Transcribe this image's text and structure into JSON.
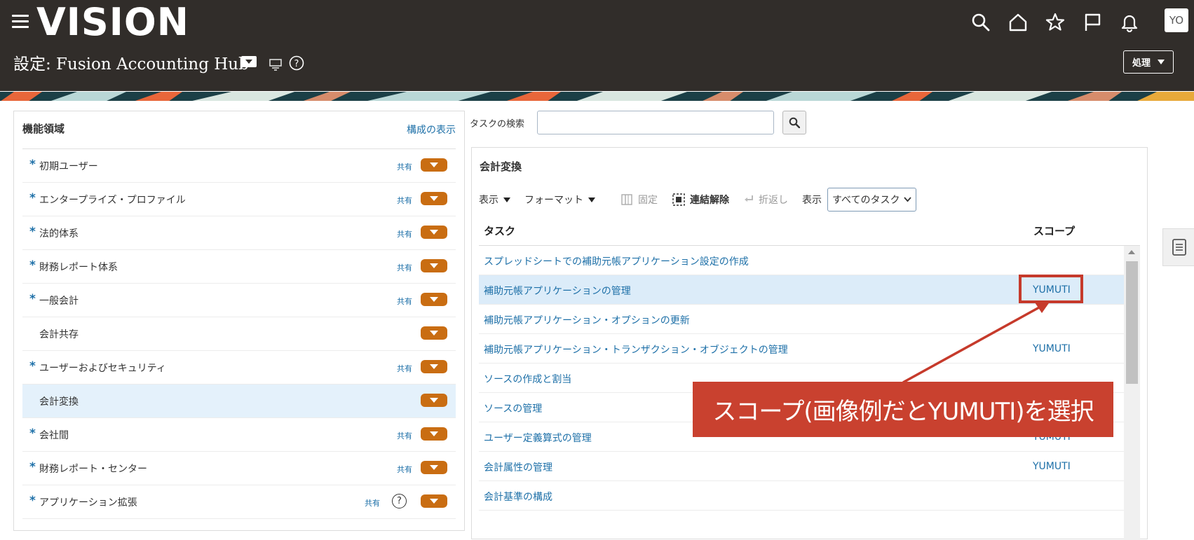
{
  "header": {
    "logo": "VISION",
    "page_title": "設定: Fusion Accounting Hub",
    "action_label": "処理",
    "avatar_initials": "YO",
    "icons": [
      "search-icon",
      "home-icon",
      "star-icon",
      "flag-icon",
      "bell-icon"
    ]
  },
  "left_panel": {
    "title": "機能領域",
    "link": "構成の表示",
    "items": [
      {
        "label": "初期ユーザー",
        "required": "*",
        "shared": "共有"
      },
      {
        "label": "エンタープライズ・プロファイル",
        "required": "*",
        "shared": "共有"
      },
      {
        "label": "法的体系",
        "required": "*",
        "shared": "共有"
      },
      {
        "label": "財務レポート体系",
        "required": "*",
        "shared": "共有"
      },
      {
        "label": "一般会計",
        "required": "*",
        "shared": "共有"
      },
      {
        "label": "会計共存",
        "required": "",
        "shared": ""
      },
      {
        "label": "ユーザーおよびセキュリティ",
        "required": "*",
        "shared": "共有"
      },
      {
        "label": "会計変換",
        "required": "",
        "shared": ""
      },
      {
        "label": "会社間",
        "required": "*",
        "shared": "共有"
      },
      {
        "label": "財務レポート・センター",
        "required": "*",
        "shared": "共有"
      },
      {
        "label": "アプリケーション拡張",
        "required": "*",
        "shared": "共有"
      }
    ]
  },
  "search": {
    "label": "タスクの検索",
    "value": ""
  },
  "right_panel": {
    "title": "会計変換",
    "toolbar": {
      "view": "表示",
      "format": "フォーマット",
      "freeze": "固定",
      "detach": "連結解除",
      "wrap": "折返し",
      "show": "表示",
      "show_value": "すべてのタスク"
    },
    "columns": {
      "task": "タスク",
      "scope": "スコープ"
    },
    "rows": [
      {
        "task": "スプレッドシートでの補助元帳アプリケーション設定の作成",
        "scope": ""
      },
      {
        "task": "補助元帳アプリケーションの管理",
        "scope": "YUMUTI"
      },
      {
        "task": "補助元帳アプリケーション・オプションの更新",
        "scope": ""
      },
      {
        "task": "補助元帳アプリケーション・トランザクション・オブジェクトの管理",
        "scope": "YUMUTI"
      },
      {
        "task": "ソースの作成と割当",
        "scope": ""
      },
      {
        "task": "ソースの管理",
        "scope": ""
      },
      {
        "task": "ユーザー定義算式の管理",
        "scope": "YUMUTI"
      },
      {
        "task": "会計属性の管理",
        "scope": "YUMUTI"
      },
      {
        "task": "会計基準の構成",
        "scope": ""
      }
    ]
  },
  "annotation": {
    "callout": "スコープ(画像例だとYUMUTI)を選択",
    "color": "#c9412f"
  }
}
